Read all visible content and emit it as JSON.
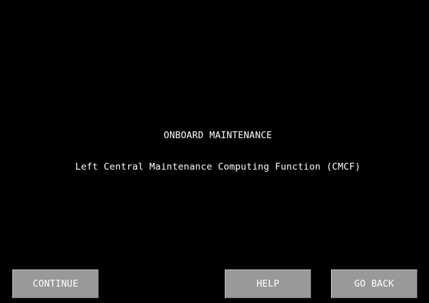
{
  "screen": {
    "title": "ONBOARD MAINTENANCE",
    "subtitle": "Left Central Maintenance Computing Function (CMCF)"
  },
  "buttons": {
    "continue_label": "CONTINUE",
    "help_label": "HELP",
    "go_back_label": "GO BACK"
  },
  "colors": {
    "background": "#000000",
    "text": "#ffffff",
    "button_face": "#999999"
  }
}
